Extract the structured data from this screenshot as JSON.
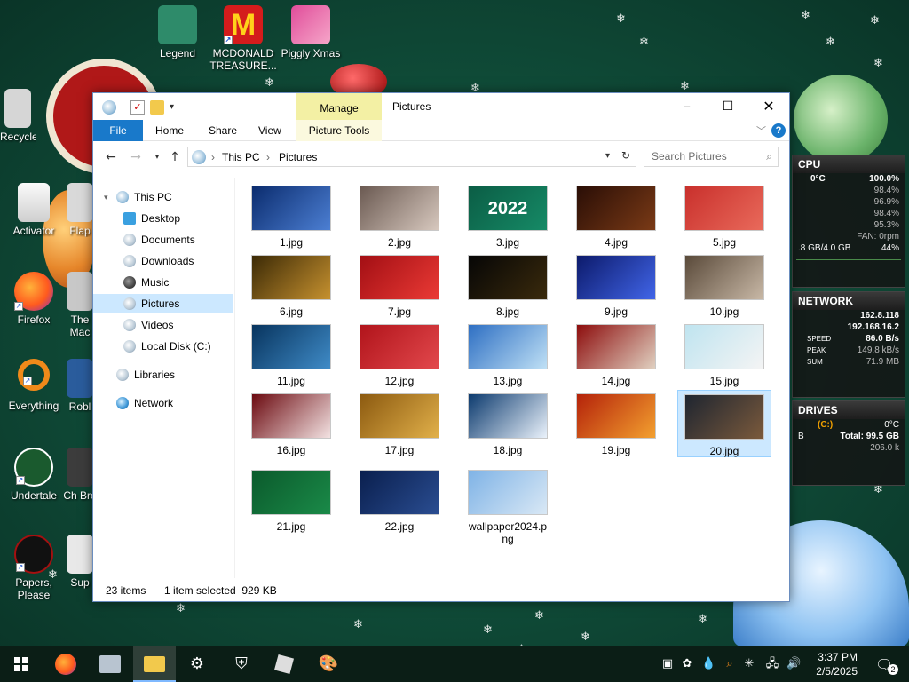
{
  "desktop": {
    "icons": [
      {
        "label": "Recycle Bin"
      },
      {
        "label": "Activator"
      },
      {
        "label": "Firefox"
      },
      {
        "label": "Everything"
      },
      {
        "label": "Undertale"
      },
      {
        "label": "Papers, Please"
      },
      {
        "label": "Legend"
      },
      {
        "label": "MCDONALD TREASURE..."
      },
      {
        "label": "Piggly Xmas"
      },
      {
        "label": "Flap"
      },
      {
        "label": "The Mac"
      },
      {
        "label": "Robl"
      },
      {
        "label": "Ch Bro"
      },
      {
        "label": "Sup"
      }
    ]
  },
  "explorer": {
    "title": "Pictures",
    "manage_label": "Manage",
    "ribbon_tabs": [
      "File",
      "Home",
      "Share",
      "View",
      "Picture Tools"
    ],
    "address": {
      "root": "This PC",
      "current": "Pictures"
    },
    "search_placeholder": "Search Pictures",
    "nav": {
      "this_pc": "This PC",
      "desktop": "Desktop",
      "documents": "Documents",
      "downloads": "Downloads",
      "music": "Music",
      "pictures": "Pictures",
      "videos": "Videos",
      "local_disk": "Local Disk (C:)",
      "libraries": "Libraries",
      "network": "Network"
    },
    "files": [
      {
        "name": "1.jpg",
        "color1": "#0b2c6e",
        "color2": "#4c7fd3"
      },
      {
        "name": "2.jpg",
        "color1": "#6b5a52",
        "color2": "#d7c8be"
      },
      {
        "name": "3.jpg",
        "color1": "#0b5d45",
        "color2": "#168a66",
        "text": "2022"
      },
      {
        "name": "4.jpg",
        "color1": "#2a0e06",
        "color2": "#7a3a16"
      },
      {
        "name": "5.jpg",
        "color1": "#c9302c",
        "color2": "#e96a5b"
      },
      {
        "name": "6.jpg",
        "color1": "#3c2a06",
        "color2": "#c6912f"
      },
      {
        "name": "7.jpg",
        "color1": "#a30f14",
        "color2": "#ea3a35"
      },
      {
        "name": "8.jpg",
        "color1": "#060606",
        "color2": "#3a2a0c"
      },
      {
        "name": "9.jpg",
        "color1": "#0c1a6b",
        "color2": "#4165e8"
      },
      {
        "name": "10.jpg",
        "color1": "#5a4a3a",
        "color2": "#c8b8a6"
      },
      {
        "name": "11.jpg",
        "color1": "#08345e",
        "color2": "#3f8bc7"
      },
      {
        "name": "12.jpg",
        "color1": "#b1141b",
        "color2": "#e2484c"
      },
      {
        "name": "13.jpg",
        "color1": "#2e6fc3",
        "color2": "#bfe0f5"
      },
      {
        "name": "14.jpg",
        "color1": "#8d0d0d",
        "color2": "#e0d0c0"
      },
      {
        "name": "15.jpg",
        "color1": "#bfe4f0",
        "color2": "#f4f4f4"
      },
      {
        "name": "16.jpg",
        "color1": "#6b0a10",
        "color2": "#f3e2e2"
      },
      {
        "name": "17.jpg",
        "color1": "#8c5a10",
        "color2": "#e1b04a"
      },
      {
        "name": "18.jpg",
        "color1": "#0c3a6e",
        "color2": "#eaf2fb"
      },
      {
        "name": "19.jpg",
        "color1": "#b4220a",
        "color2": "#f3a02f"
      },
      {
        "name": "20.jpg",
        "color1": "#1e2530",
        "color2": "#7b5a3c"
      },
      {
        "name": "21.jpg",
        "color1": "#0b5a2c",
        "color2": "#1a8a48"
      },
      {
        "name": "22.jpg",
        "color1": "#0a1f4e",
        "color2": "#2a4d91"
      },
      {
        "name": "wallpaper2024.png",
        "color1": "#7fb3e6",
        "color2": "#d9e8f5"
      }
    ],
    "status": {
      "count": "23 items",
      "selection": "1 item selected  929 KB"
    }
  },
  "gadgets": {
    "cpu": {
      "title": "CPU",
      "temp": "0°C",
      "total": "100.0%",
      "cores": [
        "98.4%",
        "96.9%",
        "98.4%",
        "95.3%"
      ],
      "fan": "FAN: 0rpm",
      "ram": ".8 GB/4.0 GB",
      "ram_pct": "44%"
    },
    "network": {
      "title": "NETWORK",
      "ip1": "162.8.118",
      "ip2": "192.168.16.2",
      "speed_label": "SPEED",
      "speed": "86.0 B/s",
      "peak_label": "PEAK",
      "peak": "149.8 kB/s",
      "sum_label": "SUM",
      "sum": "71.9 MB"
    },
    "drives": {
      "title": "DRIVES",
      "drive": "(C:)",
      "temp": "0°C",
      "total": "Total: 99.5 GB",
      "used_prefix": "B",
      "rate": "206.0 k"
    }
  },
  "taskbar": {
    "time": "3:37 PM",
    "date": "2/5/2025",
    "notification_count": "2"
  }
}
